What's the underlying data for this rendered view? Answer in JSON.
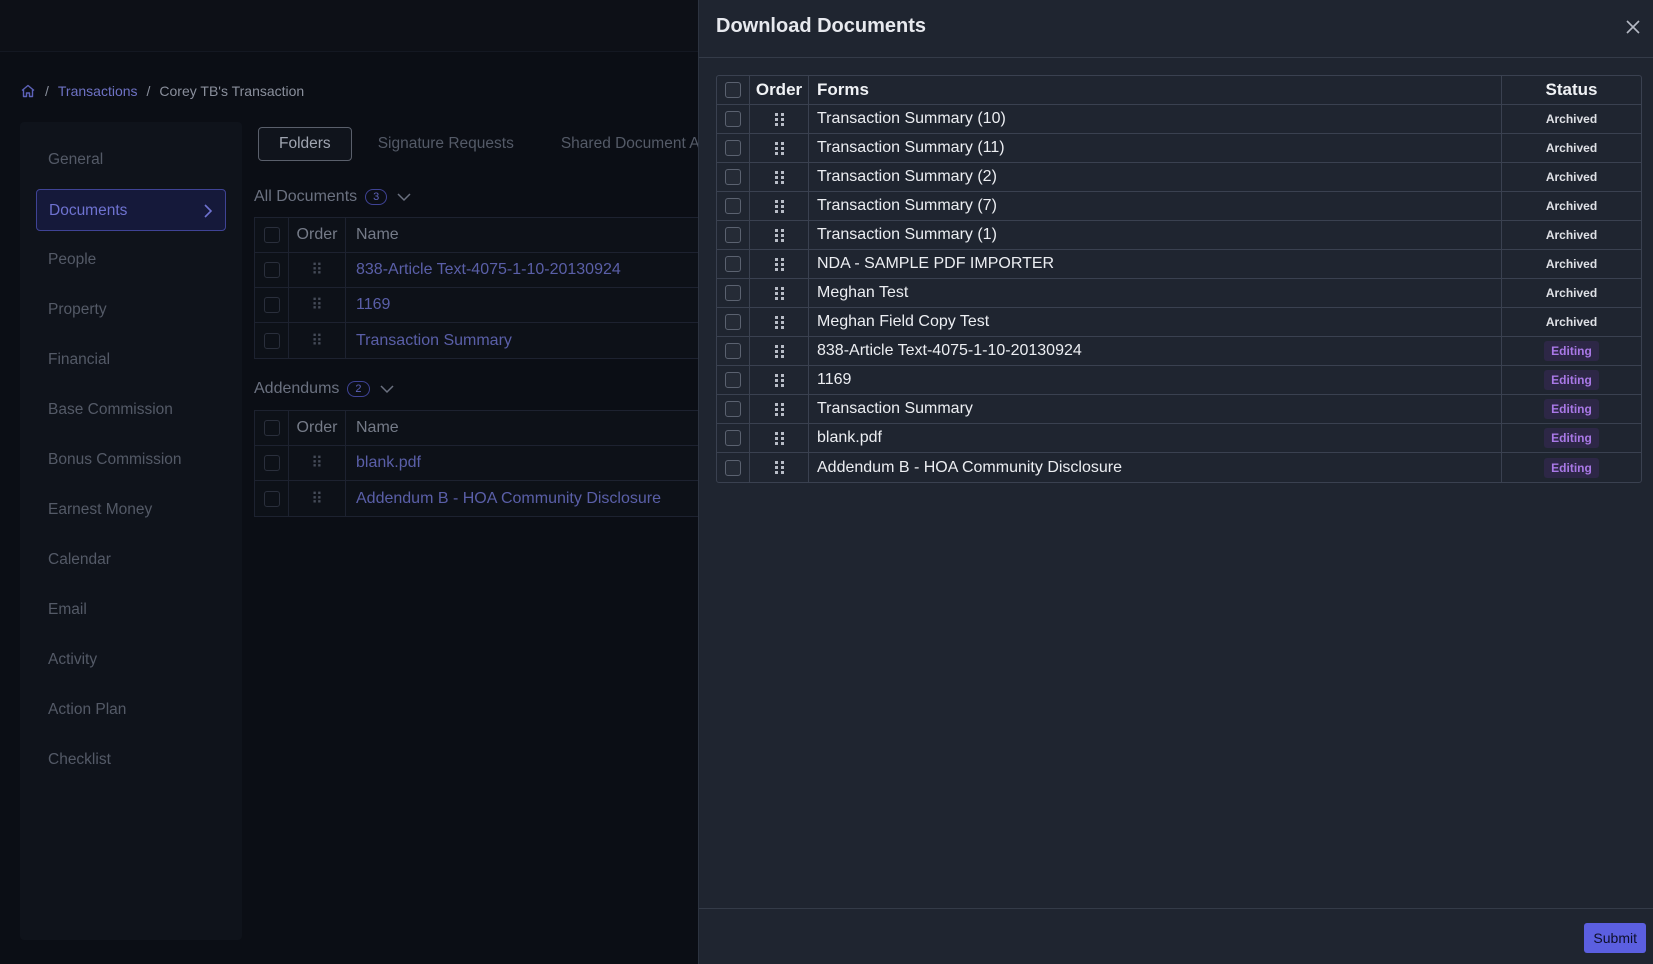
{
  "breadcrumb": {
    "items": [
      "Transactions",
      "Corey TB's Transaction"
    ]
  },
  "sidebar": {
    "items": [
      {
        "label": "General"
      },
      {
        "label": "Documents"
      },
      {
        "label": "People"
      },
      {
        "label": "Property"
      },
      {
        "label": "Financial"
      },
      {
        "label": "Base Commission"
      },
      {
        "label": "Bonus Commission"
      },
      {
        "label": "Earnest Money"
      },
      {
        "label": "Calendar"
      },
      {
        "label": "Email"
      },
      {
        "label": "Activity"
      },
      {
        "label": "Action Plan"
      },
      {
        "label": "Checklist"
      }
    ]
  },
  "tabs": [
    "Folders",
    "Signature Requests",
    "Shared Document Acc"
  ],
  "all_documents": {
    "title": "All Documents",
    "count": "3",
    "headers": {
      "order": "Order",
      "name": "Name"
    },
    "rows": [
      "838-Article Text-4075-1-10-20130924",
      "1169",
      "Transaction Summary"
    ]
  },
  "addendums": {
    "title": "Addendums",
    "count": "2",
    "headers": {
      "order": "Order",
      "name": "Name"
    },
    "rows": [
      "blank.pdf",
      "Addendum B - HOA Community Disclosure"
    ]
  },
  "drawer": {
    "title": "Download Documents",
    "headers": {
      "order": "Order",
      "forms": "Forms",
      "status": "Status"
    },
    "rows": [
      {
        "form": "Transaction Summary (10)",
        "status": "Archived"
      },
      {
        "form": "Transaction Summary (11)",
        "status": "Archived"
      },
      {
        "form": "Transaction Summary (2)",
        "status": "Archived"
      },
      {
        "form": "Transaction Summary (7)",
        "status": "Archived"
      },
      {
        "form": "Transaction Summary (1)",
        "status": "Archived"
      },
      {
        "form": "NDA - SAMPLE PDF IMPORTER",
        "status": "Archived"
      },
      {
        "form": "Meghan Test",
        "status": "Archived"
      },
      {
        "form": "Meghan Field Copy Test",
        "status": "Archived"
      },
      {
        "form": "838-Article Text-4075-1-10-20130924",
        "status": "Editing"
      },
      {
        "form": "1169",
        "status": "Editing"
      },
      {
        "form": "Transaction Summary",
        "status": "Editing"
      },
      {
        "form": "blank.pdf",
        "status": "Editing"
      },
      {
        "form": "Addendum B - HOA Community Disclosure",
        "status": "Editing"
      }
    ],
    "submit_label": "Submit"
  },
  "colors": {
    "accent": "#5b5fe0",
    "drawer_bg": "#1f2530",
    "editing_badge": "#a978e6"
  }
}
